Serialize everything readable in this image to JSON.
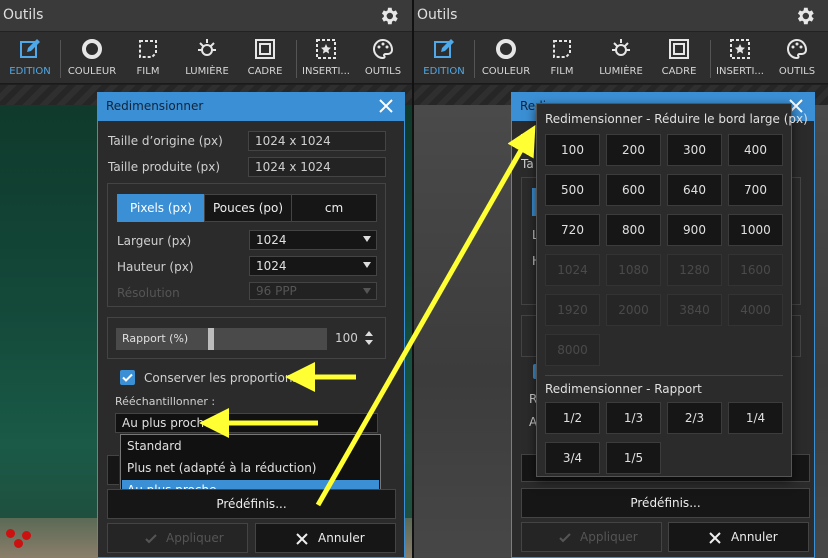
{
  "app_title": "Outils",
  "toolbar": {
    "items": [
      {
        "label": "EDITION",
        "icon": "edit-icon"
      },
      {
        "label": "COULEUR",
        "icon": "color-circle-icon"
      },
      {
        "label": "FILM",
        "icon": "film-icon"
      },
      {
        "label": "LUMIÈRE",
        "icon": "light-icon"
      },
      {
        "label": "CADRE",
        "icon": "frame-icon"
      },
      {
        "label": "INSERTI...",
        "icon": "insert-icon"
      },
      {
        "label": "OUTILS",
        "icon": "palette-icon"
      }
    ],
    "active_index": 0,
    "active_color": "#4fa8e8"
  },
  "dialog": {
    "title": "Redimensionner",
    "title_partial": "Redi",
    "orig_label": "Taille d’origine (px)",
    "orig_value": "1024 x 1024",
    "prod_label": "Taille produite (px)",
    "prod_value": "1024 x 1024",
    "unit_tabs": [
      "Pixels (px)",
      "Pouces (po)",
      "cm"
    ],
    "unit_active": 0,
    "width_label": "Largeur (px)",
    "width_value": "1024",
    "height_label": "Hauteur (px)",
    "height_value": "1024",
    "res_label": "Résolution",
    "res_value": "96 PPP",
    "ratio_label": "Rapport (%)",
    "ratio_value": "100",
    "ratio_fraction": 0.45,
    "keep_label": "Conserver les proportions",
    "keep_checked": true,
    "resample_label": "Rééchantillonner :",
    "resample_value": "Au plus proche",
    "resample_options": [
      "Standard",
      "Plus net (adapté à la réduction)",
      "Au plus proche"
    ],
    "resample_selected": 2,
    "presets_label": "Prédéfinis...",
    "apply_label": "Appliquer",
    "cancel_label": "Annuler",
    "accent": "#3b8fd4"
  },
  "popup": {
    "title_long": "Redimensionner - Réduire le bord large (px)",
    "long_edges": [
      {
        "v": "100",
        "enabled": true
      },
      {
        "v": "200",
        "enabled": true
      },
      {
        "v": "300",
        "enabled": true
      },
      {
        "v": "400",
        "enabled": true
      },
      {
        "v": "500",
        "enabled": true
      },
      {
        "v": "600",
        "enabled": true
      },
      {
        "v": "640",
        "enabled": true
      },
      {
        "v": "700",
        "enabled": true
      },
      {
        "v": "720",
        "enabled": true
      },
      {
        "v": "800",
        "enabled": true
      },
      {
        "v": "900",
        "enabled": true
      },
      {
        "v": "1000",
        "enabled": true
      },
      {
        "v": "1024",
        "enabled": false
      },
      {
        "v": "1080",
        "enabled": false
      },
      {
        "v": "1280",
        "enabled": false
      },
      {
        "v": "1600",
        "enabled": false
      },
      {
        "v": "1920",
        "enabled": false
      },
      {
        "v": "2000",
        "enabled": false
      },
      {
        "v": "3840",
        "enabled": false
      },
      {
        "v": "4000",
        "enabled": false
      },
      {
        "v": "8000",
        "enabled": false
      }
    ],
    "title_ratio": "Redimensionner - Rapport",
    "ratios": [
      "1/2",
      "1/3",
      "2/3",
      "1/4",
      "3/4",
      "1/5"
    ]
  },
  "right_dialog_fragments": {
    "ta1": "Ta",
    "ta2": "Ta",
    "l": "L",
    "h": "H",
    "r": "R",
    "a": "A"
  },
  "annotation_color": "#ffff33"
}
